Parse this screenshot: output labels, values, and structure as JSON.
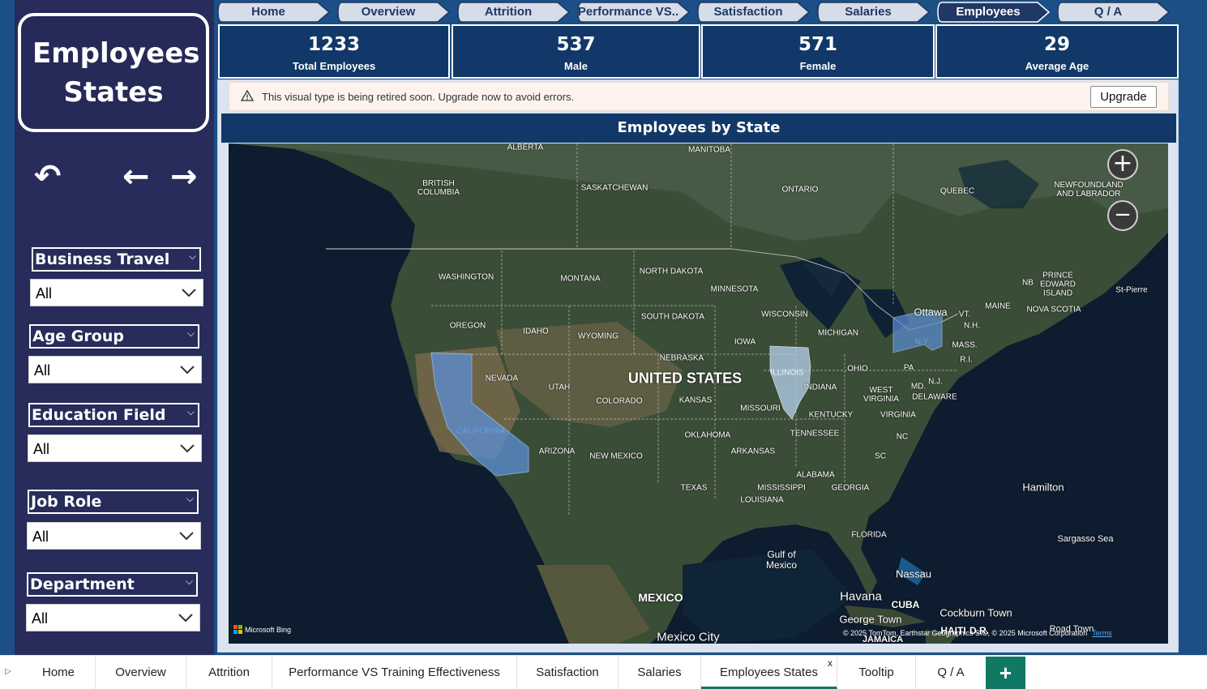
{
  "sidebar": {
    "title": "Employees States",
    "filters": [
      {
        "label": "Business Travel",
        "value": "All"
      },
      {
        "label": "Age Group",
        "value": "All"
      },
      {
        "label": "Education Field",
        "value": "All"
      },
      {
        "label": "Job Role",
        "value": "All"
      },
      {
        "label": "Department",
        "value": "All"
      }
    ]
  },
  "nav": {
    "tabs": [
      "Home",
      "Overview",
      "Attrition",
      "Performance VS..",
      "Satisfaction",
      "Salaries",
      "Employees States",
      "Q / A"
    ],
    "active": "Employees States"
  },
  "kpis": [
    {
      "value": "1233",
      "label": "Total Employees"
    },
    {
      "value": "537",
      "label": "Male"
    },
    {
      "value": "571",
      "label": "Female"
    },
    {
      "value": "29",
      "label": "Average Age"
    }
  ],
  "warning": {
    "message": "This visual type is being retired soon. Upgrade now to avoid errors.",
    "button": "Upgrade"
  },
  "map": {
    "title": "Employees by State",
    "highlighted_states": [
      "CALIFORNIA",
      "ILLINOIS",
      "N.Y."
    ],
    "labels": {
      "alberta": "ALBERTA",
      "manitoba": "MANITOBA",
      "british_columbia": "BRITISH COLUMBIA",
      "saskatchewan": "SASKATCHEWAN",
      "ontario": "ONTARIO",
      "quebec": "QUEBEC",
      "newfoundland": "NEWFOUNDLAND AND LABRADOR",
      "washington": "WASHINGTON",
      "montana": "MONTANA",
      "north_dakota": "NORTH DAKOTA",
      "minnesota": "MINNESOTA",
      "prince_edward": "PRINCE EDWARD ISLAND",
      "nb": "NB",
      "st_pierre": "St-Pierre",
      "ottawa": "Ottawa",
      "vt": "VT.",
      "maine": "MAINE",
      "nova_scotia": "NOVA SCOTIA",
      "oregon": "OREGON",
      "idaho": "IDAHO",
      "south_dakota": "SOUTH DAKOTA",
      "wisconsin": "WISCONSIN",
      "nh": "N.H.",
      "wyoming": "WYOMING",
      "michigan": "MICHIGAN",
      "iowa": "IOWA",
      "ny": "N.Y.",
      "mass": "MASS.",
      "ri": "R.I.",
      "nebraska": "NEBRASKA",
      "illinois": "ILLINOIS",
      "ohio": "OHIO",
      "pa": "PA",
      "nevada": "NEVADA",
      "united_states": "UNITED STATES",
      "utah": "UTAH",
      "indiana": "INDIANA",
      "nj": "N.J.",
      "west_virginia": "WEST VIRGINIA",
      "md": "MD.",
      "delaware": "DELAWARE",
      "colorado": "COLORADO",
      "kansas": "KANSAS",
      "missouri": "MISSOURI",
      "california": "CALIFORNIA",
      "kentucky": "KENTUCKY",
      "virginia": "VIRGINIA",
      "tennessee": "TENNESSEE",
      "oklahoma": "OKLAHOMA",
      "nc": "NC",
      "arizona": "ARIZONA",
      "arkansas": "ARKANSAS",
      "new_mexico": "NEW MEXICO",
      "sc": "SC",
      "alabama": "ALABAMA",
      "texas": "TEXAS",
      "mississippi": "MISSISSIPPI",
      "georgia": "GEORGIA",
      "louisiana": "LOUISIANA",
      "hamilton": "Hamilton",
      "florida": "FLORIDA",
      "sargasso": "Sargasso Sea",
      "gulf": "Gulf of Mexico",
      "nassau": "Nassau",
      "mexico": "MEXICO",
      "havana": "Havana",
      "cuba": "CUBA",
      "cockburn": "Cockburn Town",
      "george_town": "George Town",
      "road_town": "Road Town",
      "haiti": "HAITI",
      "dr": "D.R.",
      "jamaica": "JAMAICA",
      "mexico_city": "Mexico City"
    },
    "attribution": "Microsoft Bing",
    "copyright": "© 2025 TomTom, Earthstar Geographics SIO, © 2025 Microsoft Corporation",
    "terms": "Terms"
  },
  "tabs": {
    "items": [
      "Home",
      "Overview",
      "Attrition",
      "Performance VS Training Effectiveness",
      "Satisfaction",
      "Salaries",
      "Employees States",
      "Tooltip",
      "Q / A"
    ],
    "active": "Employees States",
    "close": "x",
    "add": "+"
  },
  "colors": {
    "sidebar": "#272c5b",
    "kpi": "#113868",
    "highlight": "#5b8fd6",
    "tab_accent": "#117865"
  }
}
